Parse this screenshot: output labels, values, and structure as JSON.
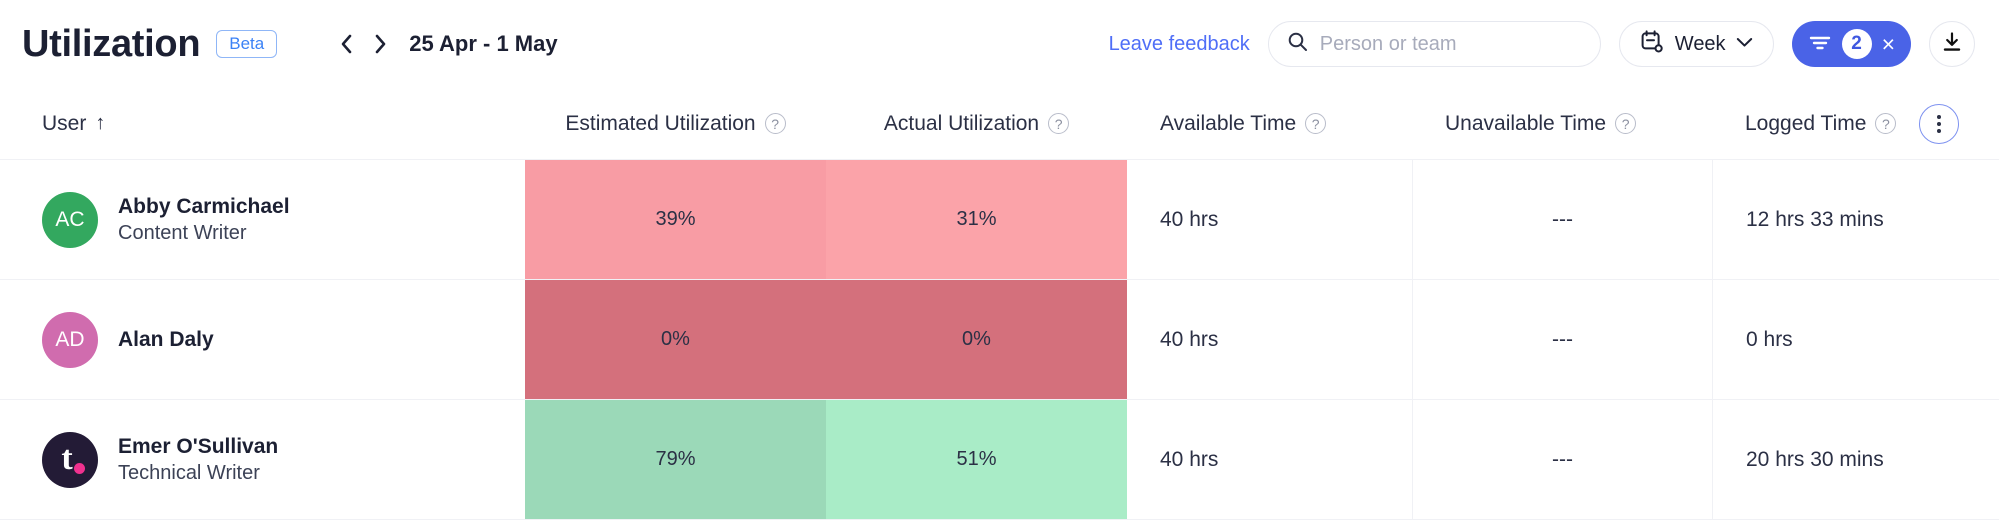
{
  "header": {
    "title": "Utilization",
    "badge": "Beta",
    "prev_icon": "chevron-left-icon",
    "next_icon": "chevron-right-icon",
    "date_range": "25 Apr - 1 May",
    "feedback_label": "Leave feedback",
    "search": {
      "value": "",
      "placeholder": "Person or team",
      "icon": "search-icon"
    },
    "period": {
      "label": "Week",
      "icon": "calendar-icon",
      "caret": "chevron-down-icon"
    },
    "filter": {
      "icon": "filter-icon",
      "count": "2",
      "clear": "×"
    },
    "download": {
      "icon": "download-icon"
    }
  },
  "table": {
    "columns": [
      {
        "label": "User",
        "sort": "↑",
        "help": false
      },
      {
        "label": "Estimated Utilization",
        "help": true
      },
      {
        "label": "Actual Utilization",
        "help": true
      },
      {
        "label": "Available Time",
        "help": true
      },
      {
        "label": "Unavailable Time",
        "help": true
      },
      {
        "label": "Logged Time",
        "help": true
      }
    ],
    "help_glyph": "?",
    "options_icon": "kebab-menu-icon",
    "rows": [
      {
        "initials": "AC",
        "avatar_color": "#33a85f",
        "avatar_type": "initials",
        "name": "Abby Carmichael",
        "role": "Content Writer",
        "estimated": "39%",
        "estimated_color": "#f89ca4",
        "actual": "31%",
        "actual_color": "#fba3a9",
        "available": "40 hrs",
        "unavailable": "---",
        "logged": "12 hrs 33 mins"
      },
      {
        "initials": "AD",
        "avatar_color": "#d06cae",
        "avatar_type": "initials",
        "name": "Alan Daly",
        "role": "",
        "estimated": "0%",
        "estimated_color": "#d4707c",
        "actual": "0%",
        "actual_color": "#d4707c",
        "available": "40 hrs",
        "unavailable": "---",
        "logged": "0 hrs"
      },
      {
        "initials": "t.",
        "avatar_color": "#231b36",
        "avatar_type": "logo",
        "name": "Emer O'Sullivan",
        "role": "Technical Writer",
        "estimated": "79%",
        "estimated_color": "#9bd9b8",
        "actual": "51%",
        "actual_color": "#a9ecc7",
        "available": "40 hrs",
        "unavailable": "---",
        "logged": "20 hrs 30 mins"
      }
    ]
  },
  "colors": {
    "accent": "#4a63e7",
    "link": "#4f6ef7",
    "beta_border": "#8fb6f7",
    "border": "#f0f1f5",
    "text": "#2b3045"
  }
}
